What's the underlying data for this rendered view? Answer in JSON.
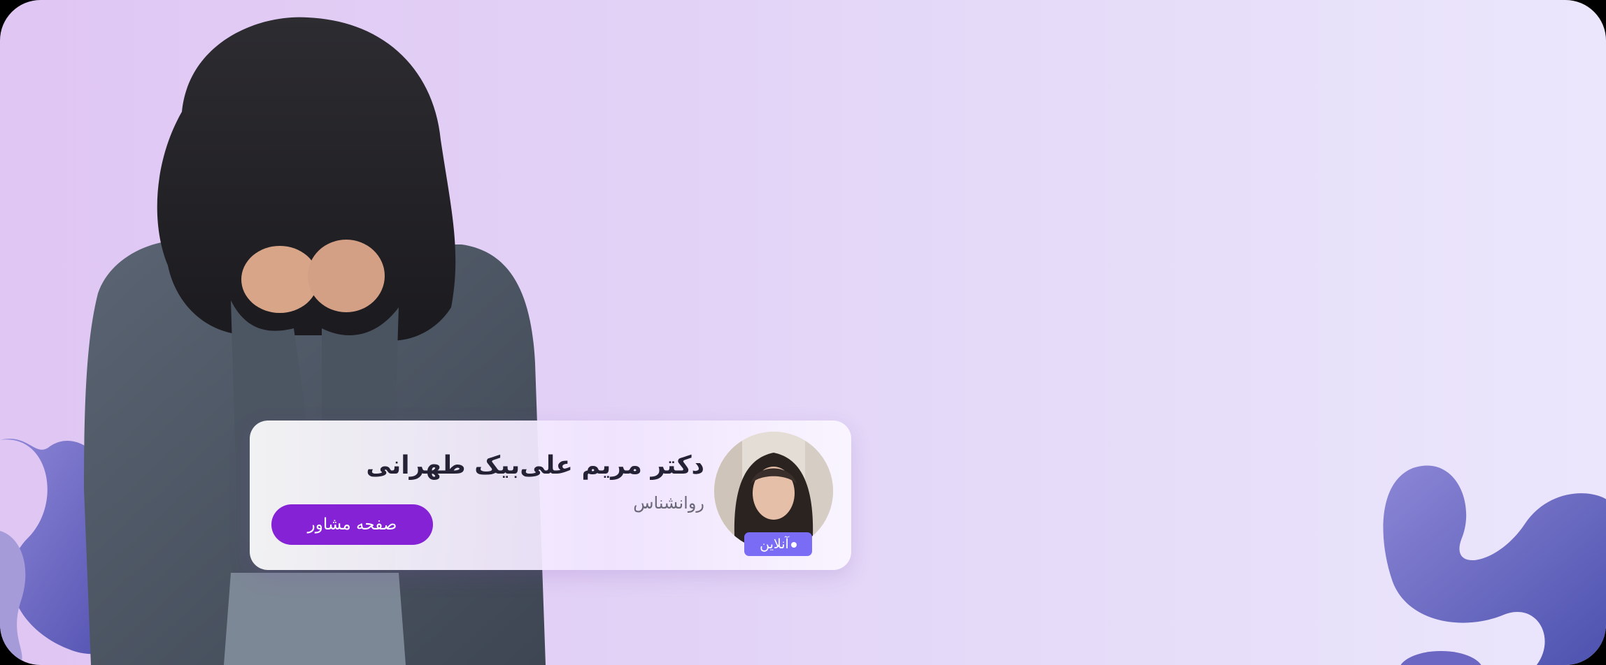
{
  "banner": {
    "background_start": "#e0c6f3",
    "background_end": "#ebe6fc",
    "blob_color": "#5a56b8"
  },
  "person_image": {
    "icon": "person-covering-face-illustration"
  },
  "consultant_card": {
    "name": "دکتر مریم علی‌بیک طهرانی",
    "role": "روانشناس",
    "status_label": "آنلاین",
    "status_color": "#7b6cf6",
    "button_label": "صفحه مشاور",
    "button_color": "#8522d6",
    "avatar_icon": "consultant-avatar"
  }
}
